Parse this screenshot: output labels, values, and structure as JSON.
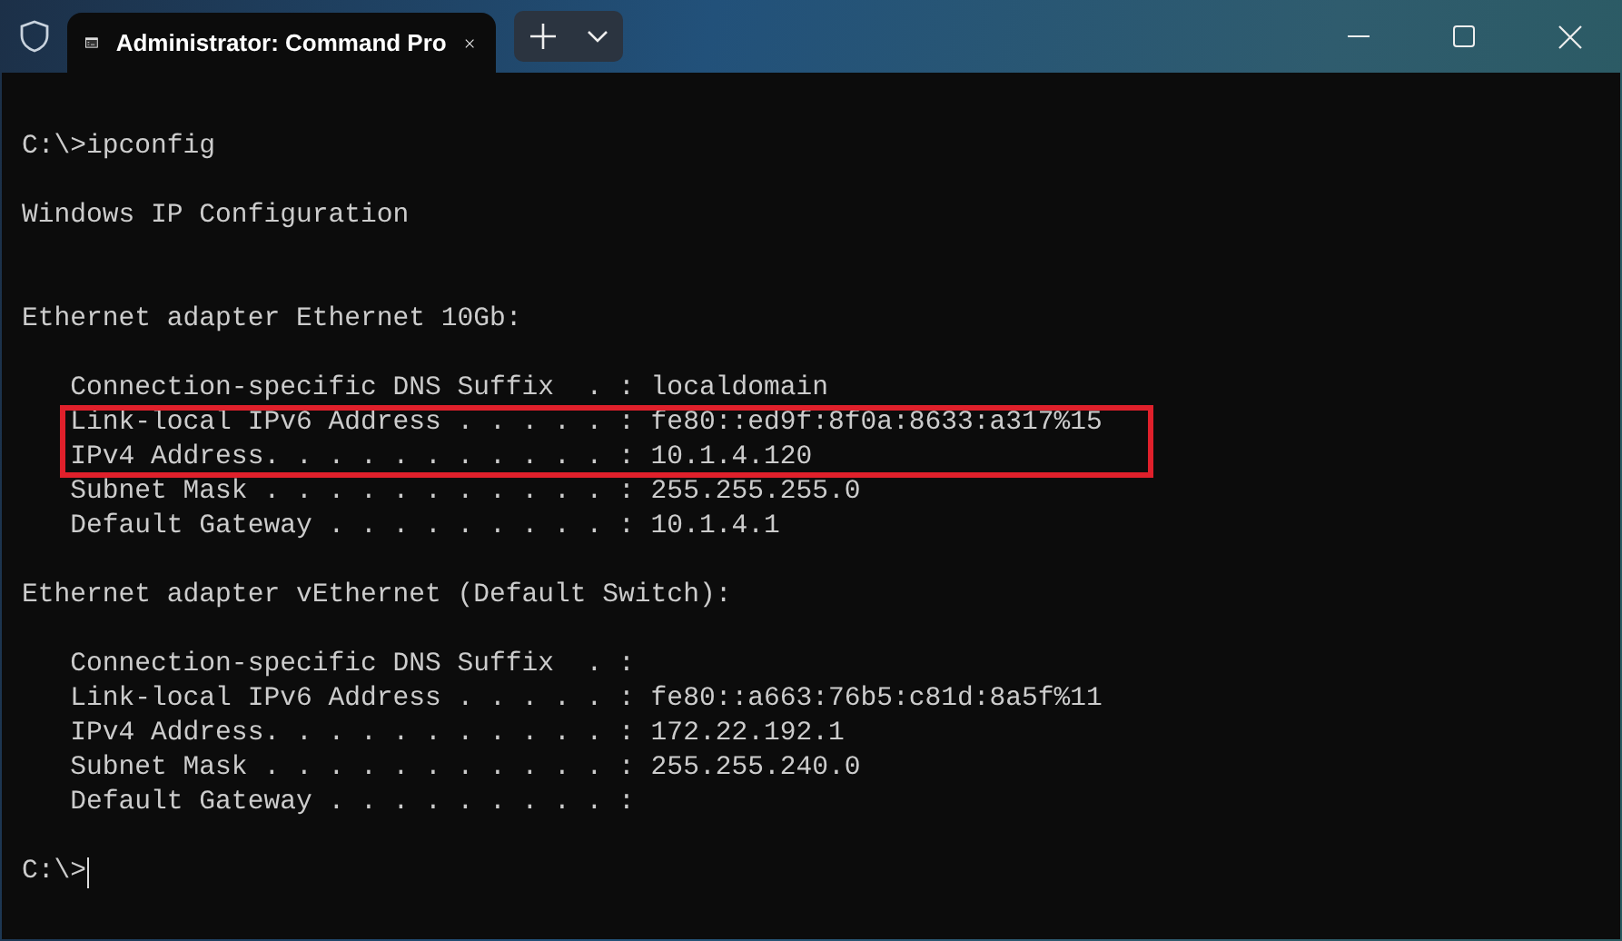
{
  "window": {
    "tab": {
      "title": "Administrator: Command Pro",
      "selected": true
    }
  },
  "terminal": {
    "lines": [
      {
        "kind": "text",
        "text": "C:\\>ipconfig",
        "highlighted": false
      },
      {
        "kind": "blank"
      },
      {
        "kind": "text",
        "text": "Windows IP Configuration",
        "highlighted": false
      },
      {
        "kind": "blank"
      },
      {
        "kind": "blank"
      },
      {
        "kind": "text",
        "text": "Ethernet adapter Ethernet 10Gb:",
        "highlighted": false
      },
      {
        "kind": "blank"
      },
      {
        "kind": "text",
        "text": "   Connection-specific DNS Suffix  . : localdomain",
        "highlighted": false
      },
      {
        "kind": "text",
        "text": "   Link-local IPv6 Address . . . . . : fe80::ed9f:8f0a:8633:a317%15",
        "highlighted": true
      },
      {
        "kind": "text",
        "text": "   IPv4 Address. . . . . . . . . . . : 10.1.4.120",
        "highlighted": true
      },
      {
        "kind": "text",
        "text": "   Subnet Mask . . . . . . . . . . . : 255.255.255.0",
        "highlighted": false
      },
      {
        "kind": "text",
        "text": "   Default Gateway . . . . . . . . . : 10.1.4.1",
        "highlighted": false
      },
      {
        "kind": "blank"
      },
      {
        "kind": "text",
        "text": "Ethernet adapter vEthernet (Default Switch):",
        "highlighted": false
      },
      {
        "kind": "blank"
      },
      {
        "kind": "text",
        "text": "   Connection-specific DNS Suffix  . :",
        "highlighted": false
      },
      {
        "kind": "text",
        "text": "   Link-local IPv6 Address . . . . . : fe80::a663:76b5:c81d:8a5f%11",
        "highlighted": false
      },
      {
        "kind": "text",
        "text": "   IPv4 Address. . . . . . . . . . . : 172.22.192.1",
        "highlighted": false
      },
      {
        "kind": "text",
        "text": "   Subnet Mask . . . . . . . . . . . : 255.255.240.0",
        "highlighted": false
      },
      {
        "kind": "text",
        "text": "   Default Gateway . . . . . . . . . :",
        "highlighted": false
      },
      {
        "kind": "blank"
      }
    ],
    "prompt": "C:\\>"
  }
}
